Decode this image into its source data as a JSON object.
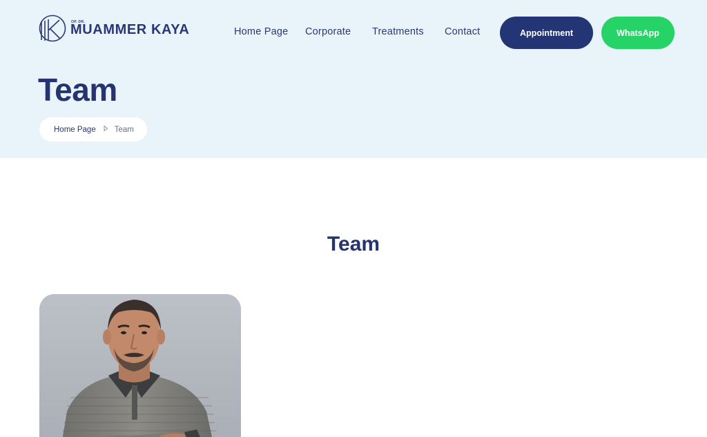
{
  "brand": {
    "prefix": "OP. DR.",
    "name": "MUAMMER KAYA"
  },
  "nav": {
    "items": [
      {
        "label": "Home Page"
      },
      {
        "label": "Corporate"
      },
      {
        "label": "Treatments"
      },
      {
        "label": "Contact"
      }
    ],
    "appointment_label": "Appointment",
    "whatsapp_label": "WhatsApp"
  },
  "hero": {
    "title": "Team",
    "breadcrumb": {
      "home": "Home Page",
      "current": "Team"
    }
  },
  "main": {
    "section_title": "Team",
    "members": [
      {
        "photo": "doctor-portrait"
      }
    ]
  },
  "colors": {
    "navy": "#25336f",
    "hero_bg": "#e9f4fa",
    "whatsapp": "#25d366"
  }
}
